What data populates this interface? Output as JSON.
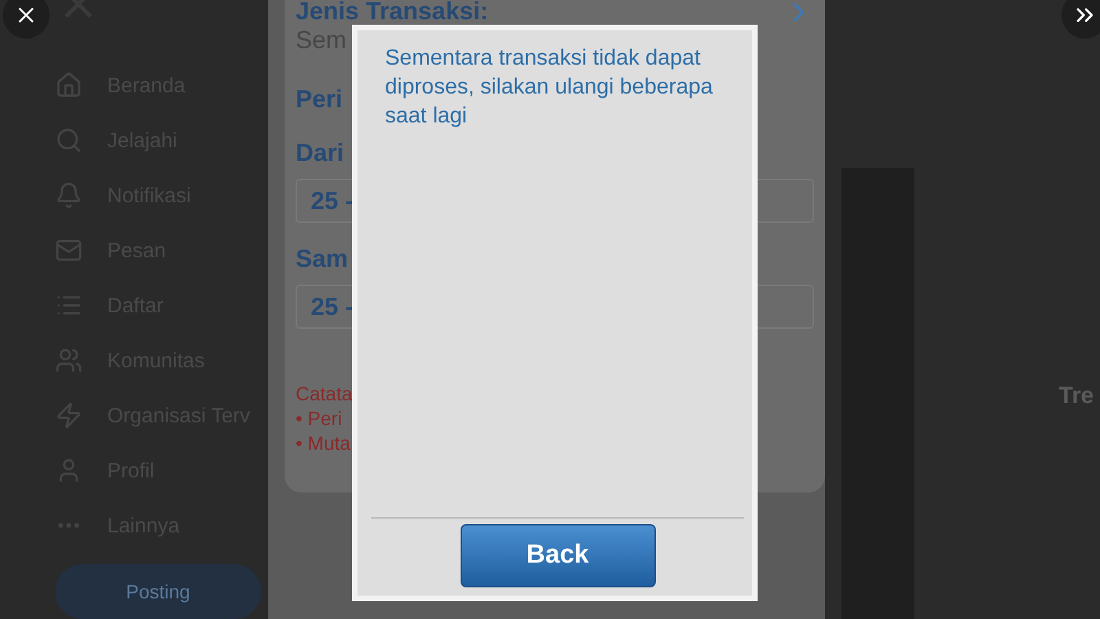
{
  "sidebar": {
    "items": [
      {
        "label": "Beranda"
      },
      {
        "label": "Jelajahi"
      },
      {
        "label": "Notifikasi"
      },
      {
        "label": "Pesan"
      },
      {
        "label": "Daftar"
      },
      {
        "label": "Komunitas"
      },
      {
        "label": "Organisasi Terv"
      },
      {
        "label": "Profil"
      },
      {
        "label": "Lainnya"
      }
    ],
    "post_button": "Posting"
  },
  "media": {
    "form": {
      "type_label": "Jenis Transaksi:",
      "type_value": "Sem",
      "period_label": "Peri",
      "from_label": "Dari",
      "from_value": "25 -",
      "to_label": "Sam",
      "to_value": "25 -",
      "note_title": "Catata",
      "notes": [
        "• Peri",
        "• Muta"
      ]
    },
    "dialog": {
      "message": "Sementara transaksi tidak dapat diproses, silakan ulangi beberapa saat lagi",
      "button": "Back"
    }
  },
  "right_panel": {
    "heading": "Tre"
  }
}
